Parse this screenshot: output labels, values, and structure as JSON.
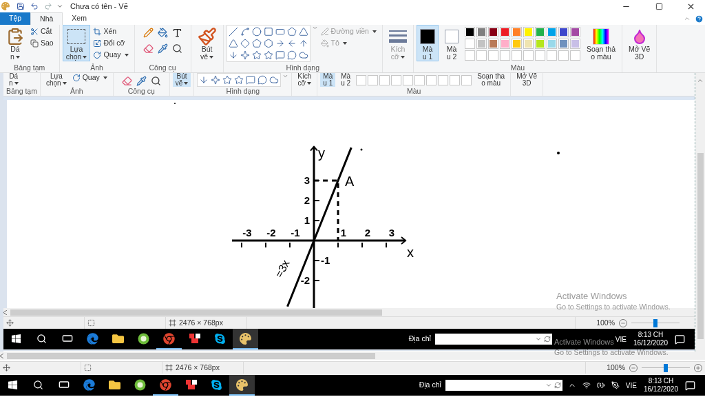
{
  "window": {
    "title": "Chưa có tên - Vẽ"
  },
  "tabs": [
    {
      "label": "Tệp",
      "kind": "file",
      "selected": false
    },
    {
      "label": "Nhà",
      "kind": "tab",
      "selected": true
    },
    {
      "label": "Xem",
      "kind": "tab",
      "selected": false
    }
  ],
  "ribbon": [
    {
      "label": "Bảng tạm",
      "items": [
        {
          "kind": "paste",
          "lines": [
            "Dá",
            "n"
          ],
          "dropdown": true
        },
        {
          "kind": "cut",
          "lines": [
            "Cắt"
          ]
        },
        {
          "kind": "copy",
          "lines": [
            "Sao"
          ]
        }
      ]
    },
    {
      "label": "Ảnh",
      "items": [
        {
          "kind": "select",
          "lines": [
            "Lựa",
            "chọn"
          ],
          "dropdown": true,
          "selected": true
        },
        {
          "kind": "crop",
          "lines": [
            "Xén"
          ]
        },
        {
          "kind": "resize",
          "lines": [
            "Đổi cỡ"
          ]
        },
        {
          "kind": "rotate",
          "lines": [
            "Quay"
          ],
          "dropdown": true
        }
      ]
    },
    {
      "label": "Công cụ",
      "items": [
        {
          "kind": "tools"
        }
      ]
    },
    {
      "items": [
        {
          "kind": "brush",
          "lines": [
            "Bút",
            "vẽ"
          ],
          "dropdown": true,
          "selected": false
        }
      ]
    },
    {
      "label": "Hình dạng",
      "items": [
        {
          "kind": "shapes"
        },
        {
          "kind": "outline",
          "lines": [
            "Đường viền"
          ],
          "dropdown": true,
          "disabled": true
        },
        {
          "kind": "fill",
          "lines": [
            "Tô"
          ],
          "dropdown": true,
          "disabled": true
        }
      ]
    },
    {
      "items": [
        {
          "kind": "size",
          "lines": [
            "Kích",
            "cỡ"
          ],
          "dropdown": true,
          "disabled": true
        }
      ]
    },
    {
      "label": "Màu",
      "items": [
        {
          "kind": "color1",
          "lines": [
            "Mà",
            "u 1"
          ],
          "selected": true
        },
        {
          "kind": "color2",
          "lines": [
            "Mà",
            "u 2"
          ],
          "selected": false
        },
        {
          "kind": "palette",
          "swatches": [
            {
              "color": "#000000"
            },
            {
              "color": "#7f7f7f"
            },
            {
              "color": "#880015"
            },
            {
              "color": "#ed1c24"
            },
            {
              "color": "#ff7f27"
            },
            {
              "color": "#fff200"
            },
            {
              "color": "#22b14c"
            },
            {
              "color": "#00a2e8"
            },
            {
              "color": "#3f48cc"
            },
            {
              "color": "#a349a4"
            },
            {
              "color": "#ffffff"
            },
            {
              "color": "#c3c3c3"
            },
            {
              "color": "#b97a57"
            },
            {
              "color": "#ffaec9"
            },
            {
              "color": "#ffc90e"
            },
            {
              "color": "#efe4b0"
            },
            {
              "color": "#b5e61d"
            },
            {
              "color": "#99d9ea"
            },
            {
              "color": "#7092be"
            },
            {
              "color": "#c8bfe7"
            },
            {
              "kind": "empty"
            },
            {
              "kind": "empty"
            },
            {
              "kind": "empty"
            },
            {
              "kind": "empty"
            },
            {
              "kind": "empty"
            },
            {
              "kind": "empty"
            },
            {
              "kind": "empty"
            },
            {
              "kind": "empty"
            },
            {
              "kind": "empty"
            },
            {
              "kind": "empty"
            }
          ]
        },
        {
          "kind": "edit",
          "lines": [
            "Soạn thả",
            "o màu"
          ]
        }
      ]
    },
    {
      "items": [
        {
          "kind": "paint3d",
          "lines": [
            "Mở Vẽ",
            "3D"
          ]
        }
      ]
    }
  ],
  "pasted_image": {
    "ribbon": [
      {
        "label": "Bảng tạm",
        "items": [
          {
            "kind": "paste",
            "lines": [
              "Dá",
              "n"
            ],
            "dropdown": true
          }
        ]
      },
      {
        "label": "Ảnh",
        "items": [
          {
            "kind": "select",
            "lines": [
              "Lựa",
              "chọn"
            ],
            "dropdown": true
          },
          {
            "kind": "rotate",
            "lines": [
              "Quay"
            ],
            "dropdown": true
          }
        ]
      },
      {
        "label": "Công cụ",
        "items": [
          {
            "kind": "tools"
          }
        ]
      },
      {
        "items": [
          {
            "kind": "brush",
            "lines": [
              "Bút",
              "vẽ"
            ],
            "dropdown": true,
            "selected": true
          }
        ]
      },
      {
        "label": "Hình dạng",
        "items": [
          {
            "kind": "shapes"
          }
        ]
      },
      {
        "items": [
          {
            "kind": "size",
            "lines": [
              "Kích",
              "cỡ"
            ],
            "dropdown": true
          }
        ]
      },
      {
        "label": "Màu",
        "items": [
          {
            "kind": "color1",
            "lines": [
              "Mà",
              "u 1"
            ],
            "selected": true
          },
          {
            "kind": "color2",
            "lines": [
              "Mà",
              "u 2"
            ],
            "selected": false
          },
          {
            "kind": "palette",
            "swatches": [
              {
                "kind": "empty"
              },
              {
                "kind": "empty"
              },
              {
                "kind": "empty"
              },
              {
                "kind": "empty"
              },
              {
                "kind": "empty"
              },
              {
                "kind": "empty"
              },
              {
                "kind": "empty"
              },
              {
                "kind": "empty"
              },
              {
                "kind": "empty"
              },
              {
                "kind": "empty"
              }
            ]
          },
          {
            "kind": "edit",
            "lines": [
              "Soạn tha",
              "o màu"
            ]
          }
        ]
      },
      {
        "items": [
          {
            "kind": "paint3d",
            "lines": [
              "Mở Vẽ",
              "3D"
            ]
          }
        ]
      }
    ],
    "canvas": {
      "x_labels": [
        "-3",
        "-2",
        "-1",
        "1",
        "2",
        "3"
      ],
      "y_labels": [
        "3",
        "2",
        "1",
        "-1",
        "-2"
      ],
      "x_axis_label": "x",
      "y_axis_label": "y",
      "point_label": "A",
      "line_label": "=3x"
    },
    "status_bar": {
      "size": "2476 × 768px",
      "zoom": "100%",
      "level": 0.5,
      "zoom_in": false
    },
    "taskbar": {
      "apps": [
        {
          "kind": "start",
          "running": false,
          "selected": false
        },
        {
          "kind": "search",
          "running": false,
          "selected": false
        },
        {
          "kind": "taskview",
          "running": false,
          "selected": false
        },
        {
          "kind": "edge",
          "running": false,
          "selected": false
        },
        {
          "kind": "explorer",
          "running": false,
          "selected": false
        },
        {
          "kind": "green",
          "running": false,
          "selected": false
        },
        {
          "kind": "chrome",
          "running": true,
          "selected": false
        },
        {
          "kind": "cards",
          "running": false,
          "selected": false
        },
        {
          "kind": "skype",
          "running": false,
          "selected": false
        },
        {
          "kind": "paint",
          "running": true,
          "selected": true
        }
      ],
      "address_label": "Địa chỉ",
      "language": "VIE",
      "time": "8:13 CH",
      "date": "16/12/2020"
    }
  },
  "status_bar": {
    "size": "2476 × 768px",
    "zoom": "100%",
    "level": 0.5,
    "zoom_in": true
  },
  "taskbar": {
    "apps": [
      {
        "kind": "start",
        "running": false,
        "selected": false
      },
      {
        "kind": "search",
        "running": false,
        "selected": false
      },
      {
        "kind": "taskview",
        "running": false,
        "selected": false
      },
      {
        "kind": "edge",
        "running": false,
        "selected": false
      },
      {
        "kind": "explorer",
        "running": false,
        "selected": false
      },
      {
        "kind": "green",
        "running": false,
        "selected": false
      },
      {
        "kind": "chrome",
        "running": true,
        "selected": false
      },
      {
        "kind": "cards",
        "running": false,
        "selected": false
      },
      {
        "kind": "skype",
        "running": false,
        "selected": false
      },
      {
        "kind": "paint",
        "running": true,
        "selected": true
      }
    ],
    "address_label": "Địa chỉ",
    "language": "VIE",
    "time": "8:13 CH",
    "date": "16/12/2020"
  },
  "activation_notices": [
    {
      "title": "Activate Windows",
      "note": "Go to Settings to activate Windows."
    },
    {
      "title": "Activate Windows",
      "note": "Go to Settings to activate Windows."
    }
  ]
}
